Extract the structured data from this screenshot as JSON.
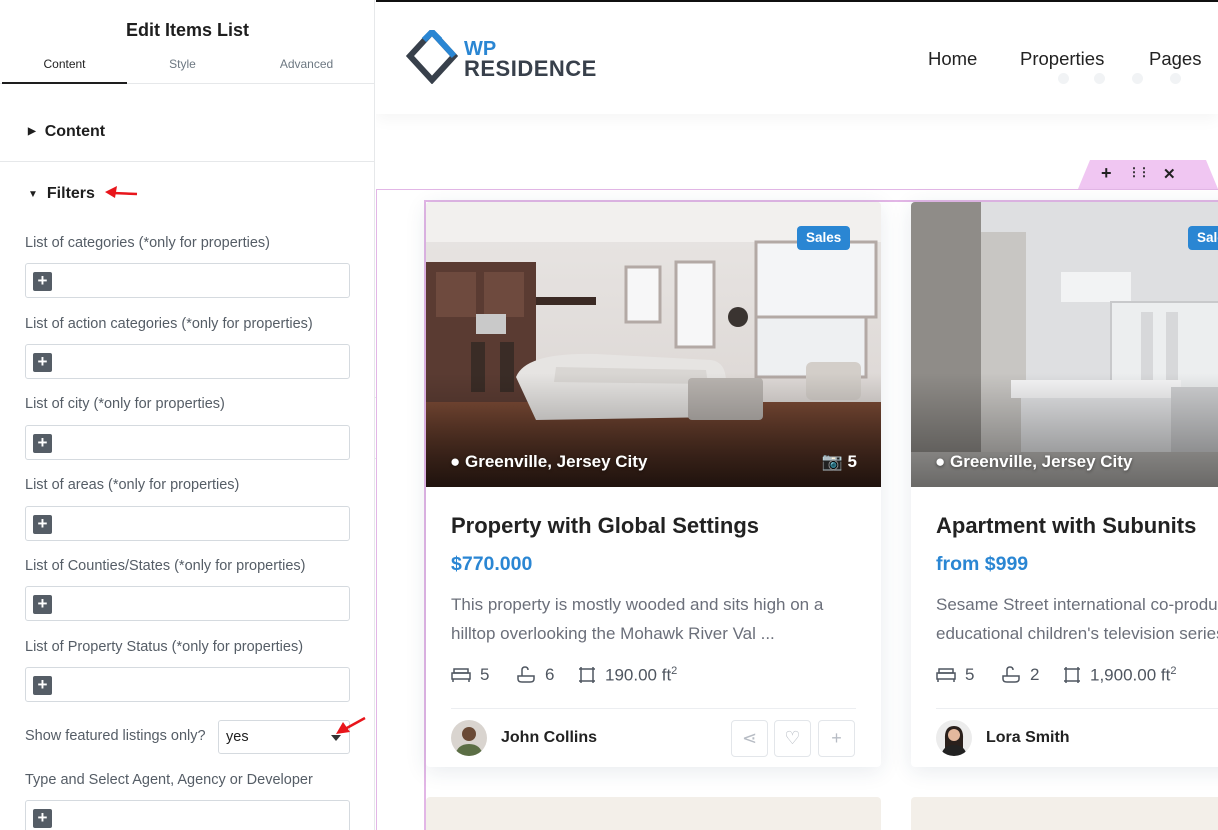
{
  "panel": {
    "title": "Edit Items List",
    "tabs": [
      {
        "label": "Content"
      },
      {
        "label": "Style"
      },
      {
        "label": "Advanced"
      }
    ],
    "sections": {
      "content": "Content",
      "filters": "Filters"
    },
    "fields": [
      {
        "label": "List of categories (*only for properties)"
      },
      {
        "label": "List of action categories (*only for properties)"
      },
      {
        "label": "List of city (*only for properties)"
      },
      {
        "label": "List of areas (*only for properties)"
      },
      {
        "label": "List of Counties/States (*only for properties)"
      },
      {
        "label": "List of Property Status (*only for properties)"
      }
    ],
    "featured": {
      "label": "Show featured listings only?",
      "value": "yes"
    },
    "agent_field": {
      "label": "Type and Select Agent, Agency or Developer"
    },
    "plus_glyph": "+",
    "annotation_color": "#e8151b"
  },
  "site": {
    "logo": {
      "line1": "WP",
      "line2": "RESIDENCE"
    },
    "nav": [
      "Home",
      "Properties",
      "Pages"
    ],
    "accent_color": "#2a86d3"
  },
  "editor_handle": {
    "add": "+",
    "drag": "⋮⋮",
    "close": "✕"
  },
  "cards": [
    {
      "badge": "Sales",
      "location": "Greenville, Jersey City",
      "photos": "5",
      "title": "Property with Global Settings",
      "price": "$770.000",
      "desc_line1": "This property is mostly wooded and sits high on a",
      "desc_line2": "hilltop overlooking the Mohawk River Val ...",
      "beds": "5",
      "baths": "6",
      "size": "190.00 ft",
      "size_sup": "2",
      "agent": "John Collins"
    },
    {
      "badge": "Sales",
      "location": "Greenville, Jersey City",
      "title": "Apartment with Subunits",
      "price": "from $999",
      "desc_line1": "Sesame Street international co-productions",
      "desc_line2": "educational children's television series",
      "beds": "5",
      "baths": "2",
      "size": "1,900.00 ft",
      "size_sup": "2",
      "agent": "Lora Smith"
    }
  ]
}
